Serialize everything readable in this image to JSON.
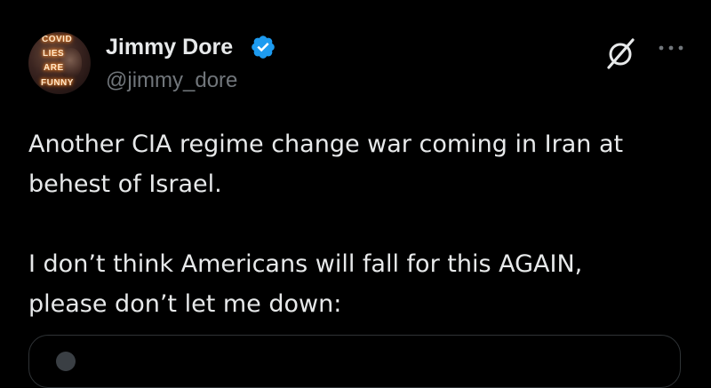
{
  "author": {
    "display_name": "Jimmy Dore",
    "handle": "@jimmy_dore",
    "verified": true,
    "avatar_text": [
      "COVID",
      "LIES",
      "ARE",
      "FUNNY"
    ]
  },
  "actions": {
    "grok_icon": "slashed-circle-icon",
    "more_icon": "ellipsis-icon"
  },
  "tweet": {
    "paragraphs": [
      "Another CIA regime change war coming in Iran at behest of Israel.",
      "I don’t think Americans will fall for this AGAIN, please don’t let me down:"
    ]
  },
  "colors": {
    "background": "#000000",
    "text_primary": "#e7e9ea",
    "text_secondary": "#71767b",
    "verified_badge": "#1d9bf0",
    "border": "#2f3336"
  }
}
